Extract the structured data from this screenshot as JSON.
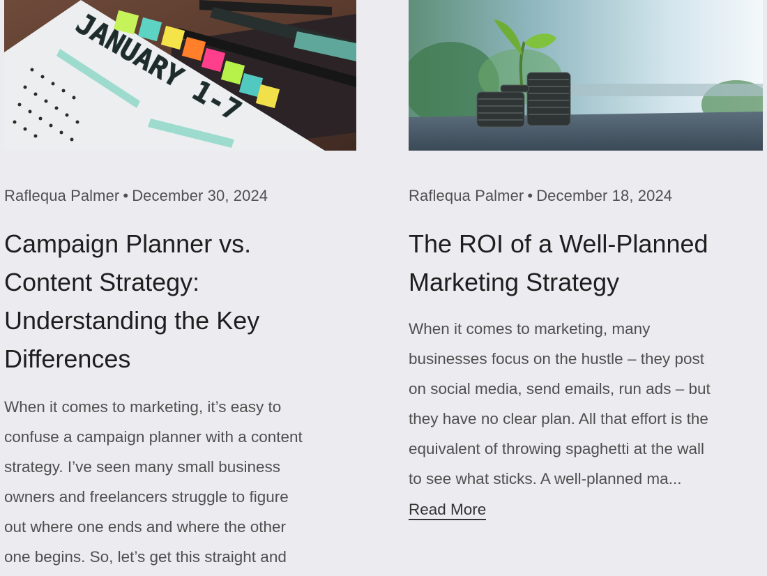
{
  "posts": [
    {
      "image_alt": "January calendar planner page with colored tabs and pens",
      "calendar_text": "JANUARY 1-7",
      "author": "Raflequa Palmer",
      "separator": "•",
      "date": "December 30, 2024",
      "title_lines": [
        "Campaign Planner vs.",
        "Content Strategy:",
        "Understanding the Key",
        "Differences"
      ],
      "excerpt_lines": [
        "When it comes to marketing, it’s easy to",
        "confuse a campaign planner with a content",
        "strategy. I’ve seen many small business",
        "owners and freelancers struggle to figure",
        "out where one ends and where the other",
        "one begins. So, let’s get this straight and"
      ]
    },
    {
      "image_alt": "Stacks of coins with a growing seedling",
      "author": "Raflequa Palmer",
      "separator": "•",
      "date": "December 18, 2024",
      "title_lines": [
        "The ROI of a Well-Planned",
        "Marketing Strategy"
      ],
      "excerpt_lines": [
        "When it comes to marketing, many",
        "businesses focus on the hustle – they post",
        "on social media, send emails, run ads – but",
        "they have no clear plan. All that effort is the",
        "equivalent of throwing spaghetti at the wall",
        "to see what sticks. A well-planned ma..."
      ],
      "read_more": "Read More"
    }
  ],
  "colors": {
    "background": "#ecebf0",
    "title": "#1e1e1e",
    "meta": "#505050",
    "excerpt": "#4f4f4f"
  }
}
